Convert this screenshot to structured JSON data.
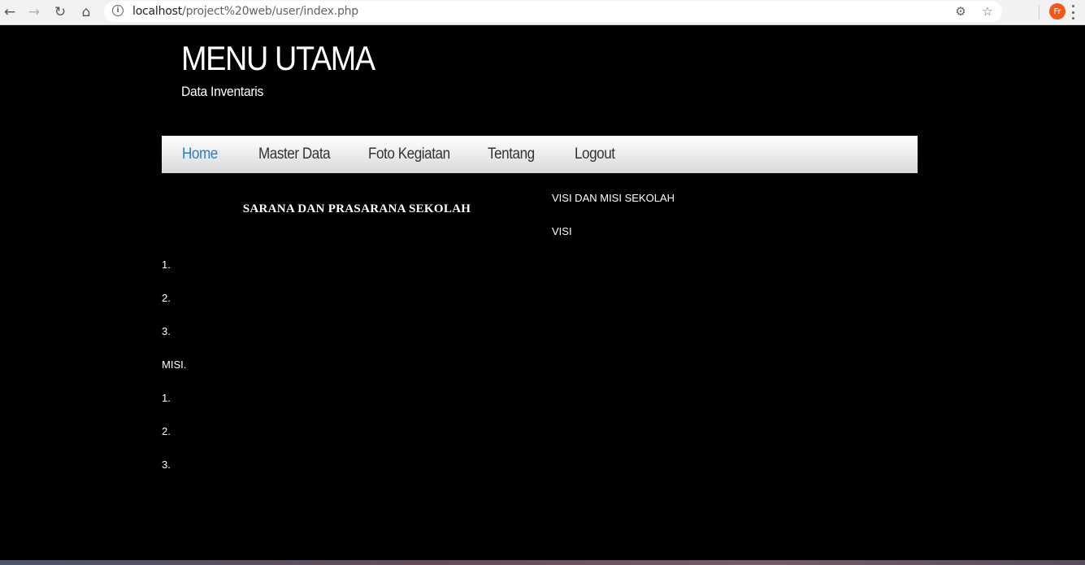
{
  "browser": {
    "url_host": "localhost",
    "url_path": "/project%20web/user/index.php",
    "profile_initials": "Fr"
  },
  "header": {
    "title": "MENU UTAMA",
    "subtitle": "Data Inventaris"
  },
  "nav": {
    "items": [
      {
        "label": "Home",
        "active": true
      },
      {
        "label": "Master Data",
        "active": false
      },
      {
        "label": "Foto Kegiatan",
        "active": false
      },
      {
        "label": "Tentang",
        "active": false
      },
      {
        "label": "Logout",
        "active": false
      }
    ]
  },
  "main": {
    "left_title": "SARANA DAN PRASARANA SEKOLAH",
    "right_title": "VISI DAN MISI SEKOLAH",
    "visi_label": "VISI",
    "visi_items": [
      "1.",
      "2.",
      "3."
    ],
    "misi_label": "MISI.",
    "misi_items": [
      "1.",
      "2.",
      "3."
    ]
  },
  "colors": {
    "background": "#000000",
    "nav_active": "#2a7fc0",
    "nav_text": "#333333"
  }
}
